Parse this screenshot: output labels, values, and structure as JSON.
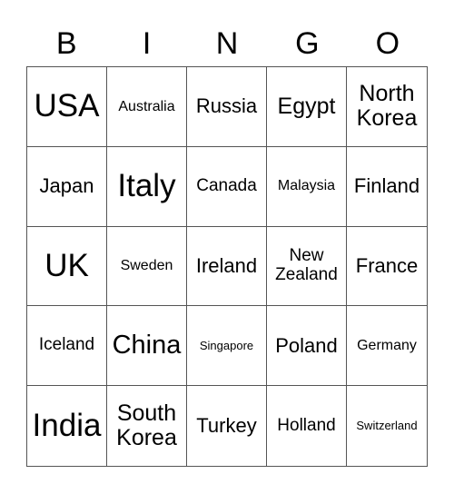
{
  "header": {
    "letters": [
      "B",
      "I",
      "N",
      "G",
      "O"
    ]
  },
  "board": {
    "rows": [
      [
        {
          "text": "USA",
          "size": "s-xl"
        },
        {
          "text": "Australia",
          "size": "s-xs"
        },
        {
          "text": "Russia",
          "size": "s-md"
        },
        {
          "text": "Egypt",
          "size": "s-ml"
        },
        {
          "text": "North Korea",
          "size": "s-ml"
        }
      ],
      [
        {
          "text": "Japan",
          "size": "s-md"
        },
        {
          "text": "Italy",
          "size": "s-xl"
        },
        {
          "text": "Canada",
          "size": "s-sm"
        },
        {
          "text": "Malaysia",
          "size": "s-xs"
        },
        {
          "text": "Finland",
          "size": "s-md"
        }
      ],
      [
        {
          "text": "UK",
          "size": "s-xl"
        },
        {
          "text": "Sweden",
          "size": "s-xs"
        },
        {
          "text": "Ireland",
          "size": "s-md"
        },
        {
          "text": "New Zealand",
          "size": "s-sm"
        },
        {
          "text": "France",
          "size": "s-md"
        }
      ],
      [
        {
          "text": "Iceland",
          "size": "s-sm"
        },
        {
          "text": "China",
          "size": "s-lg"
        },
        {
          "text": "Singapore",
          "size": "s-xxs"
        },
        {
          "text": "Poland",
          "size": "s-md"
        },
        {
          "text": "Germany",
          "size": "s-xs"
        }
      ],
      [
        {
          "text": "India",
          "size": "s-xl"
        },
        {
          "text": "South Korea",
          "size": "s-ml"
        },
        {
          "text": "Turkey",
          "size": "s-md"
        },
        {
          "text": "Holland",
          "size": "s-sm"
        },
        {
          "text": "Switzerland",
          "size": "s-xxs"
        }
      ]
    ]
  }
}
